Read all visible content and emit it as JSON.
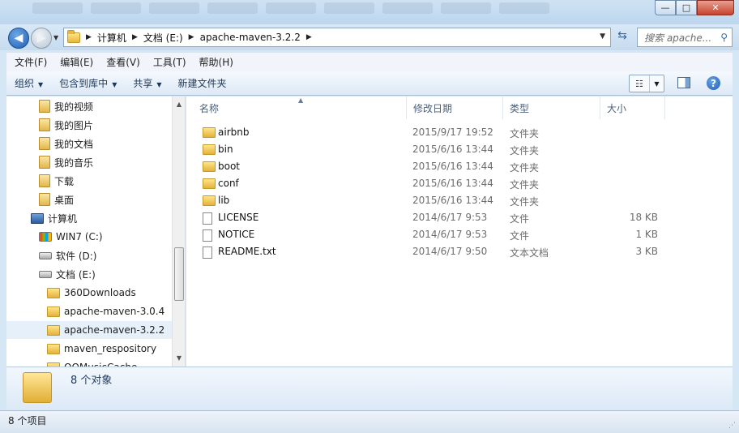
{
  "window": {
    "minimize": "—",
    "maximize": "□",
    "close": "✕"
  },
  "address": {
    "breadcrumbs": [
      "计算机",
      "文档 (E:)",
      "apache-maven-3.2.2"
    ],
    "search_placeholder": "搜索 apache..."
  },
  "menu": [
    "文件(F)",
    "编辑(E)",
    "查看(V)",
    "工具(T)",
    "帮助(H)"
  ],
  "toolbar": {
    "organize": "组织",
    "include_in_library": "包含到库中",
    "share": "共享",
    "new_folder": "新建文件夹",
    "help": "?"
  },
  "nav": {
    "items": [
      {
        "label": "我的视频",
        "icon": "library-icon"
      },
      {
        "label": "我的图片",
        "icon": "library-icon"
      },
      {
        "label": "我的文档",
        "icon": "library-icon"
      },
      {
        "label": "我的音乐",
        "icon": "library-icon"
      },
      {
        "label": "下载",
        "icon": "library-icon"
      },
      {
        "label": "桌面",
        "icon": "library-icon"
      },
      {
        "label": "计算机",
        "icon": "computer-icon"
      },
      {
        "label": "WIN7 (C:)",
        "icon": "windows-drive-icon"
      },
      {
        "label": "软件 (D:)",
        "icon": "drive-icon"
      },
      {
        "label": "文档 (E:)",
        "icon": "drive-icon"
      },
      {
        "label": "360Downloads",
        "icon": "folder-icon"
      },
      {
        "label": "apache-maven-3.0.4",
        "icon": "folder-icon"
      },
      {
        "label": "apache-maven-3.2.2",
        "icon": "folder-icon",
        "selected": true
      },
      {
        "label": "maven_respository",
        "icon": "folder-icon"
      },
      {
        "label": "QQMusicCache",
        "icon": "folder-icon"
      }
    ]
  },
  "columns": {
    "name": "名称",
    "date": "修改日期",
    "type": "类型",
    "size": "大小"
  },
  "files": [
    {
      "name": "airbnb",
      "date": "2015/9/17 19:52",
      "type": "文件夹",
      "size": "",
      "kind": "folder"
    },
    {
      "name": "bin",
      "date": "2015/6/16 13:44",
      "type": "文件夹",
      "size": "",
      "kind": "folder"
    },
    {
      "name": "boot",
      "date": "2015/6/16 13:44",
      "type": "文件夹",
      "size": "",
      "kind": "folder"
    },
    {
      "name": "conf",
      "date": "2015/6/16 13:44",
      "type": "文件夹",
      "size": "",
      "kind": "folder"
    },
    {
      "name": "lib",
      "date": "2015/6/16 13:44",
      "type": "文件夹",
      "size": "",
      "kind": "folder"
    },
    {
      "name": "LICENSE",
      "date": "2014/6/17 9:53",
      "type": "文件",
      "size": "18 KB",
      "kind": "file"
    },
    {
      "name": "NOTICE",
      "date": "2014/6/17 9:53",
      "type": "文件",
      "size": "1 KB",
      "kind": "file"
    },
    {
      "name": "README.txt",
      "date": "2014/6/17 9:50",
      "type": "文本文档",
      "size": "3 KB",
      "kind": "file"
    }
  ],
  "details": {
    "object_count": "8 个对象"
  },
  "status": {
    "item_count": "8 个项目"
  }
}
